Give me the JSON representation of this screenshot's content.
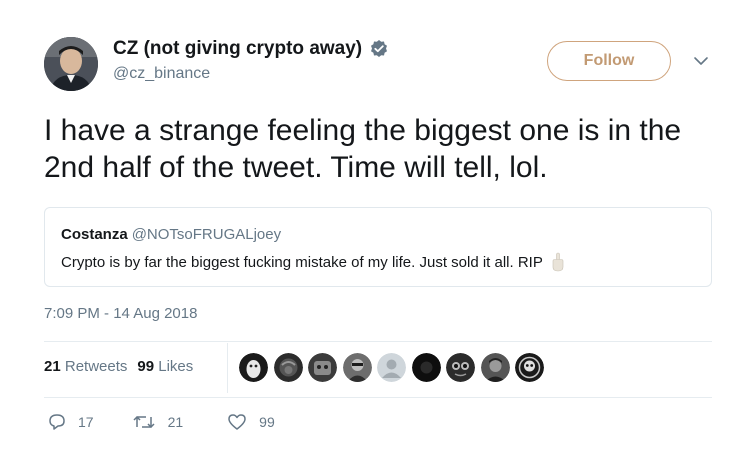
{
  "author": {
    "display_name": "CZ (not giving crypto away)",
    "handle": "@cz_binance",
    "verified": true
  },
  "follow_label": "Follow",
  "tweet_text": "I have a strange feeling the biggest one is in the 2nd half of the tweet.  Time will tell, lol.",
  "quoted": {
    "name": "Costanza",
    "handle": "@NOTsoFRUGALjoey",
    "text": "Crypto is by far the biggest fucking mistake of my life. Just sold it all. RIP"
  },
  "timestamp": "7:09 PM - 14 Aug 2018",
  "stats": {
    "retweets_count": "21",
    "retweets_label": "Retweets",
    "likes_count": "99",
    "likes_label": "Likes"
  },
  "actions": {
    "replies": "17",
    "retweets": "21",
    "likes": "99"
  },
  "colors": {
    "follow_accent": "#cfa47d",
    "verified": "#1da1f2",
    "muted": "#657786"
  }
}
